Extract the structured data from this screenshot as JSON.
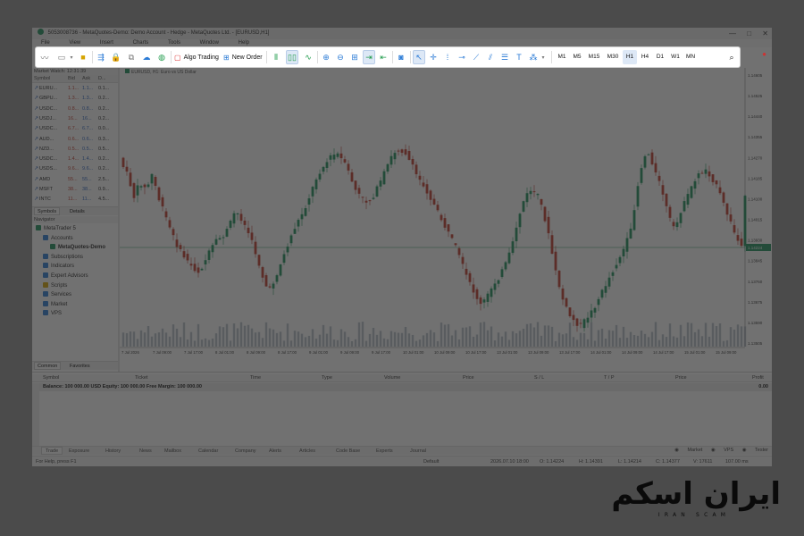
{
  "window": {
    "title": "5053008736 - MetaQuotes-Demo: Demo Account - Hedge - MetaQuotes Ltd. - [EURUSD,H1]",
    "controls": [
      "—",
      "□",
      "✕"
    ]
  },
  "menu": {
    "items": [
      "File",
      "View",
      "Insert",
      "Charts",
      "Tools",
      "Window",
      "Help"
    ]
  },
  "toolbar": {
    "algo_trading_label": "Algo Trading",
    "new_order_label": "New Order",
    "timeframes": [
      "M1",
      "M5",
      "M15",
      "M30",
      "H1",
      "H4",
      "D1",
      "W1",
      "MN"
    ],
    "active_timeframe": "H1"
  },
  "market_watch": {
    "title": "Market Watch: 12:31:39",
    "columns": [
      "Symbol",
      "Bid",
      "Ask",
      "D..."
    ],
    "rows": [
      {
        "symbol": "EURU...",
        "bid": "1.1...",
        "ask": "1.1...",
        "d": "0.1..."
      },
      {
        "symbol": "GBPU...",
        "bid": "1.3...",
        "ask": "1.3...",
        "d": "0.2..."
      },
      {
        "symbol": "USDC...",
        "bid": "0.8...",
        "ask": "0.8...",
        "d": "0.2..."
      },
      {
        "symbol": "USDJ...",
        "bid": "16...",
        "ask": "16...",
        "d": "0.2..."
      },
      {
        "symbol": "USDC...",
        "bid": "6.7...",
        "ask": "6.7...",
        "d": "0.0..."
      },
      {
        "symbol": "AUD...",
        "bid": "0.6...",
        "ask": "0.6...",
        "d": "0.3..."
      },
      {
        "symbol": "NZD...",
        "bid": "0.5...",
        "ask": "0.5...",
        "d": "0.5..."
      },
      {
        "symbol": "USDC...",
        "bid": "1.4...",
        "ask": "1.4...",
        "d": "0.2..."
      },
      {
        "symbol": "USDS...",
        "bid": "9.6...",
        "ask": "9.6...",
        "d": "0.2..."
      },
      {
        "symbol": "AMD",
        "bid": "55...",
        "ask": "55...",
        "d": "2.5..."
      },
      {
        "symbol": "MSFT",
        "bid": "38...",
        "ask": "38...",
        "d": "0.9..."
      },
      {
        "symbol": "INTC",
        "bid": "11...",
        "ask": "11...",
        "d": "4.5..."
      }
    ],
    "tabs": [
      "Symbols",
      "Details"
    ]
  },
  "navigator": {
    "title": "Navigator",
    "items": [
      {
        "label": "MetaTrader 5",
        "level": 0,
        "bold": false
      },
      {
        "label": "Accounts",
        "level": 1,
        "bold": false
      },
      {
        "label": "MetaQuotes-Demo",
        "level": 2,
        "bold": true
      },
      {
        "label": "Subscriptions",
        "level": 1,
        "bold": false
      },
      {
        "label": "Indicators",
        "level": 1,
        "bold": false
      },
      {
        "label": "Expert Advisors",
        "level": 1,
        "bold": false
      },
      {
        "label": "Scripts",
        "level": 1,
        "bold": false
      },
      {
        "label": "Services",
        "level": 1,
        "bold": false
      },
      {
        "label": "Market",
        "level": 1,
        "bold": false
      },
      {
        "label": "VPS",
        "level": 1,
        "bold": false
      }
    ],
    "tabs": [
      "Common",
      "Favorites"
    ]
  },
  "chart": {
    "label": "EURUSD, H1: Euro vs US Dollar",
    "price_labels": [
      "1.14605",
      "1.14525",
      "1.14440",
      "1.14355",
      "1.14270",
      "1.14185",
      "1.14100",
      "1.14015",
      "1.13930",
      "1.13845",
      "1.13760",
      "1.13675",
      "1.13590",
      "1.13505"
    ],
    "current_price": "1.14224",
    "time_labels": [
      "7 Jul 2026",
      "7 Jul 09:00",
      "7 Jul 17:00",
      "8 Jul 01:00",
      "8 Jul 09:00",
      "8 Jul 17:00",
      "9 Jul 01:00",
      "9 Jul 09:00",
      "9 Jul 17:00",
      "10 Jul 01:00",
      "10 Jul 09:00",
      "10 Jul 17:00",
      "13 Jul 01:00",
      "13 Jul 09:00",
      "13 Jul 17:00",
      "14 Jul 01:00",
      "14 Jul 09:00",
      "14 Jul 17:00",
      "15 Jul 01:00",
      "15 Jul 09:00"
    ],
    "bull_color": "#1c8f5b",
    "bear_color": "#c0392b"
  },
  "toolbox": {
    "columns": [
      "Symbol",
      "Ticket",
      "Time",
      "Type",
      "Volume",
      "Price",
      "S / L",
      "T / P",
      "Price",
      "Profit"
    ],
    "balance_text": "Balance: 100 000.00 USD   Equity: 100 000.00   Free Margin: 100 000.00",
    "balance_value": "0.00",
    "tabs": [
      "Trade",
      "Exposure",
      "History",
      "News",
      "Mailbox",
      "Calendar",
      "Company",
      "Alerts",
      "Articles",
      "Code Base",
      "Experts",
      "Journal"
    ],
    "right_tabs": [
      "Market",
      "VPS",
      "Tester"
    ],
    "side_label": "Toolbox"
  },
  "status": {
    "help": "For Help, press F1",
    "profile": "Default",
    "datetime": "2026.07.10 18:00",
    "open": "O: 1.14224",
    "high": "H: 1.14391",
    "low": "L: 1.14214",
    "close": "C: 1.14377",
    "volume": "V: 17611",
    "traffic": "107.00 ms"
  },
  "brand": {
    "name": "ایران اسکم",
    "sub": "IRAN SCAM"
  }
}
